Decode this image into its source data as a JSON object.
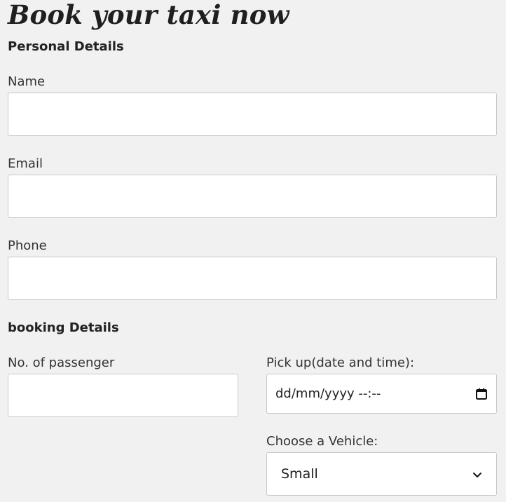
{
  "page": {
    "title": "Book your taxi now"
  },
  "personal": {
    "heading": "Personal Details",
    "name_label": "Name",
    "email_label": "Email",
    "phone_label": "Phone",
    "name_value": "",
    "email_value": "",
    "phone_value": ""
  },
  "booking": {
    "heading": "booking Details",
    "passengers_label": "No. of passenger",
    "passengers_value": "",
    "pickup_label": "Pick up(date and time):",
    "pickup_placeholder": "dd/mm/yyyy --:--",
    "vehicle_label": "Choose a Vehicle:",
    "vehicle_selected": "Small"
  },
  "icons": {
    "calendar": "calendar-icon",
    "chevron": "chevron-down-icon"
  }
}
